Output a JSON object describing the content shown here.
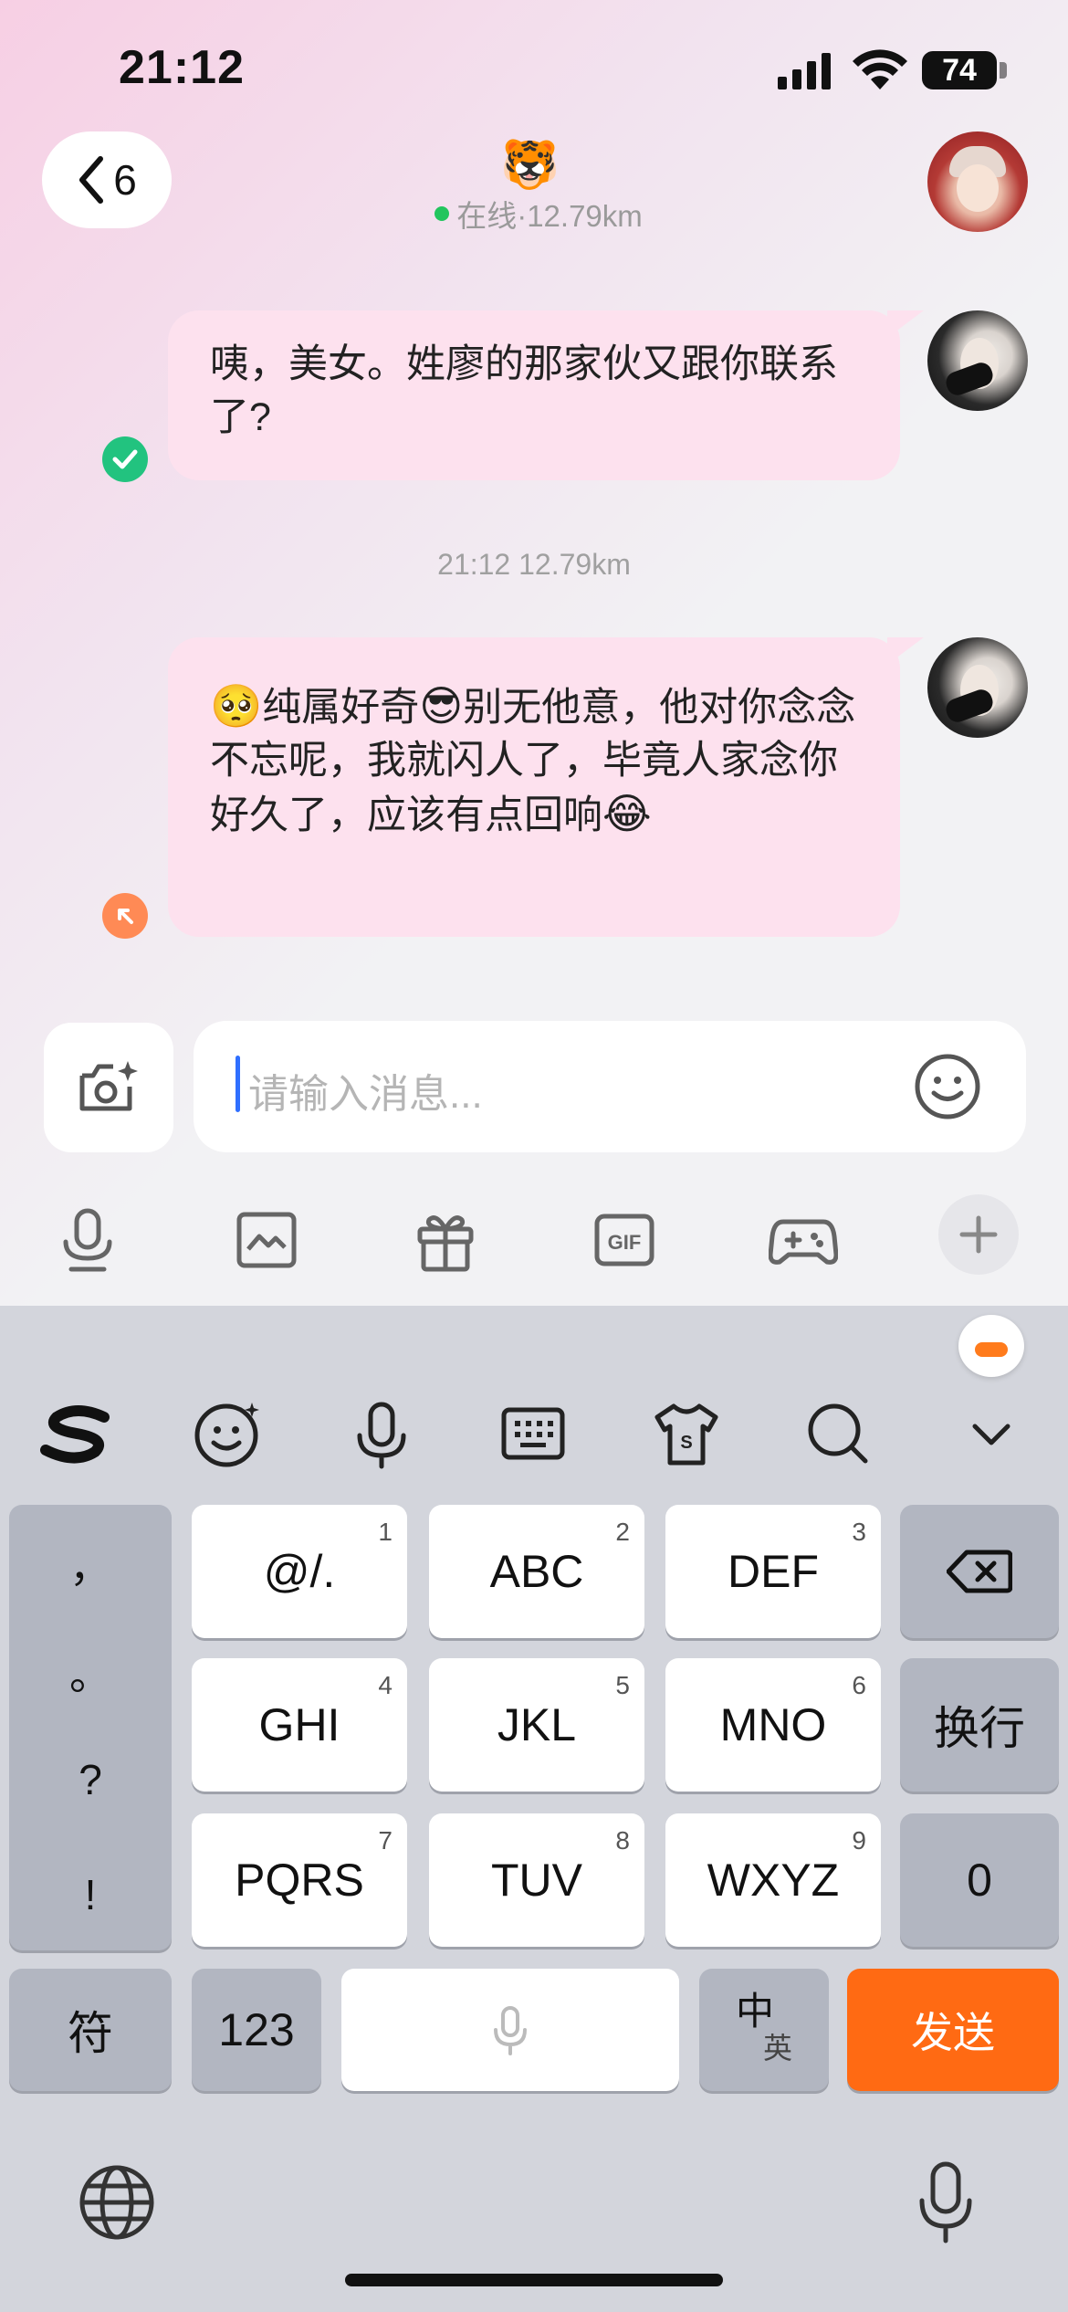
{
  "status_bar": {
    "time": "21:12",
    "battery": "74"
  },
  "header": {
    "back_count": "6",
    "contact_emoji": "🐯",
    "status": "在线·12.79km"
  },
  "messages": [
    {
      "text": "咦，美女。姓廖的那家伙又跟你联系了?",
      "status": "read"
    },
    {
      "timestamp": "21:12 12.79km"
    },
    {
      "parts": [
        "🥺",
        "纯属好奇",
        "😎",
        "别无他意，他对你念念不忘呢，我就闪人了，毕竟人家念你好久了，应该有点回响",
        "😂"
      ],
      "status": "sent"
    }
  ],
  "composer": {
    "placeholder": "请输入消息..."
  },
  "tools": [
    "mic-icon",
    "image-icon",
    "gift-icon",
    "gif-icon",
    "game-icon",
    "plus-icon"
  ],
  "keyboard": {
    "toolbar": [
      "sogou-logo",
      "emoji-icon",
      "voice-icon",
      "keyboard-icon",
      "skin-icon",
      "search-icon",
      "collapse-icon"
    ],
    "punct": [
      "，",
      "。",
      "?",
      "!"
    ],
    "keys": [
      {
        "label": "@/.",
        "num": "1"
      },
      {
        "label": "ABC",
        "num": "2"
      },
      {
        "label": "DEF",
        "num": "3"
      },
      {
        "label": "GHI",
        "num": "4"
      },
      {
        "label": "JKL",
        "num": "5"
      },
      {
        "label": "MNO",
        "num": "6"
      },
      {
        "label": "PQRS",
        "num": "7"
      },
      {
        "label": "TUV",
        "num": "8"
      },
      {
        "label": "WXYZ",
        "num": "9"
      }
    ],
    "newline": "换行",
    "zero": "0",
    "symbols": "符",
    "numbers": "123",
    "lang_main": "中",
    "lang_sub": "英",
    "send": "发送"
  },
  "colors": {
    "bubble": "#fde1ee",
    "send": "#ff6a13",
    "online": "#22c55e",
    "read": "#22c37f"
  }
}
